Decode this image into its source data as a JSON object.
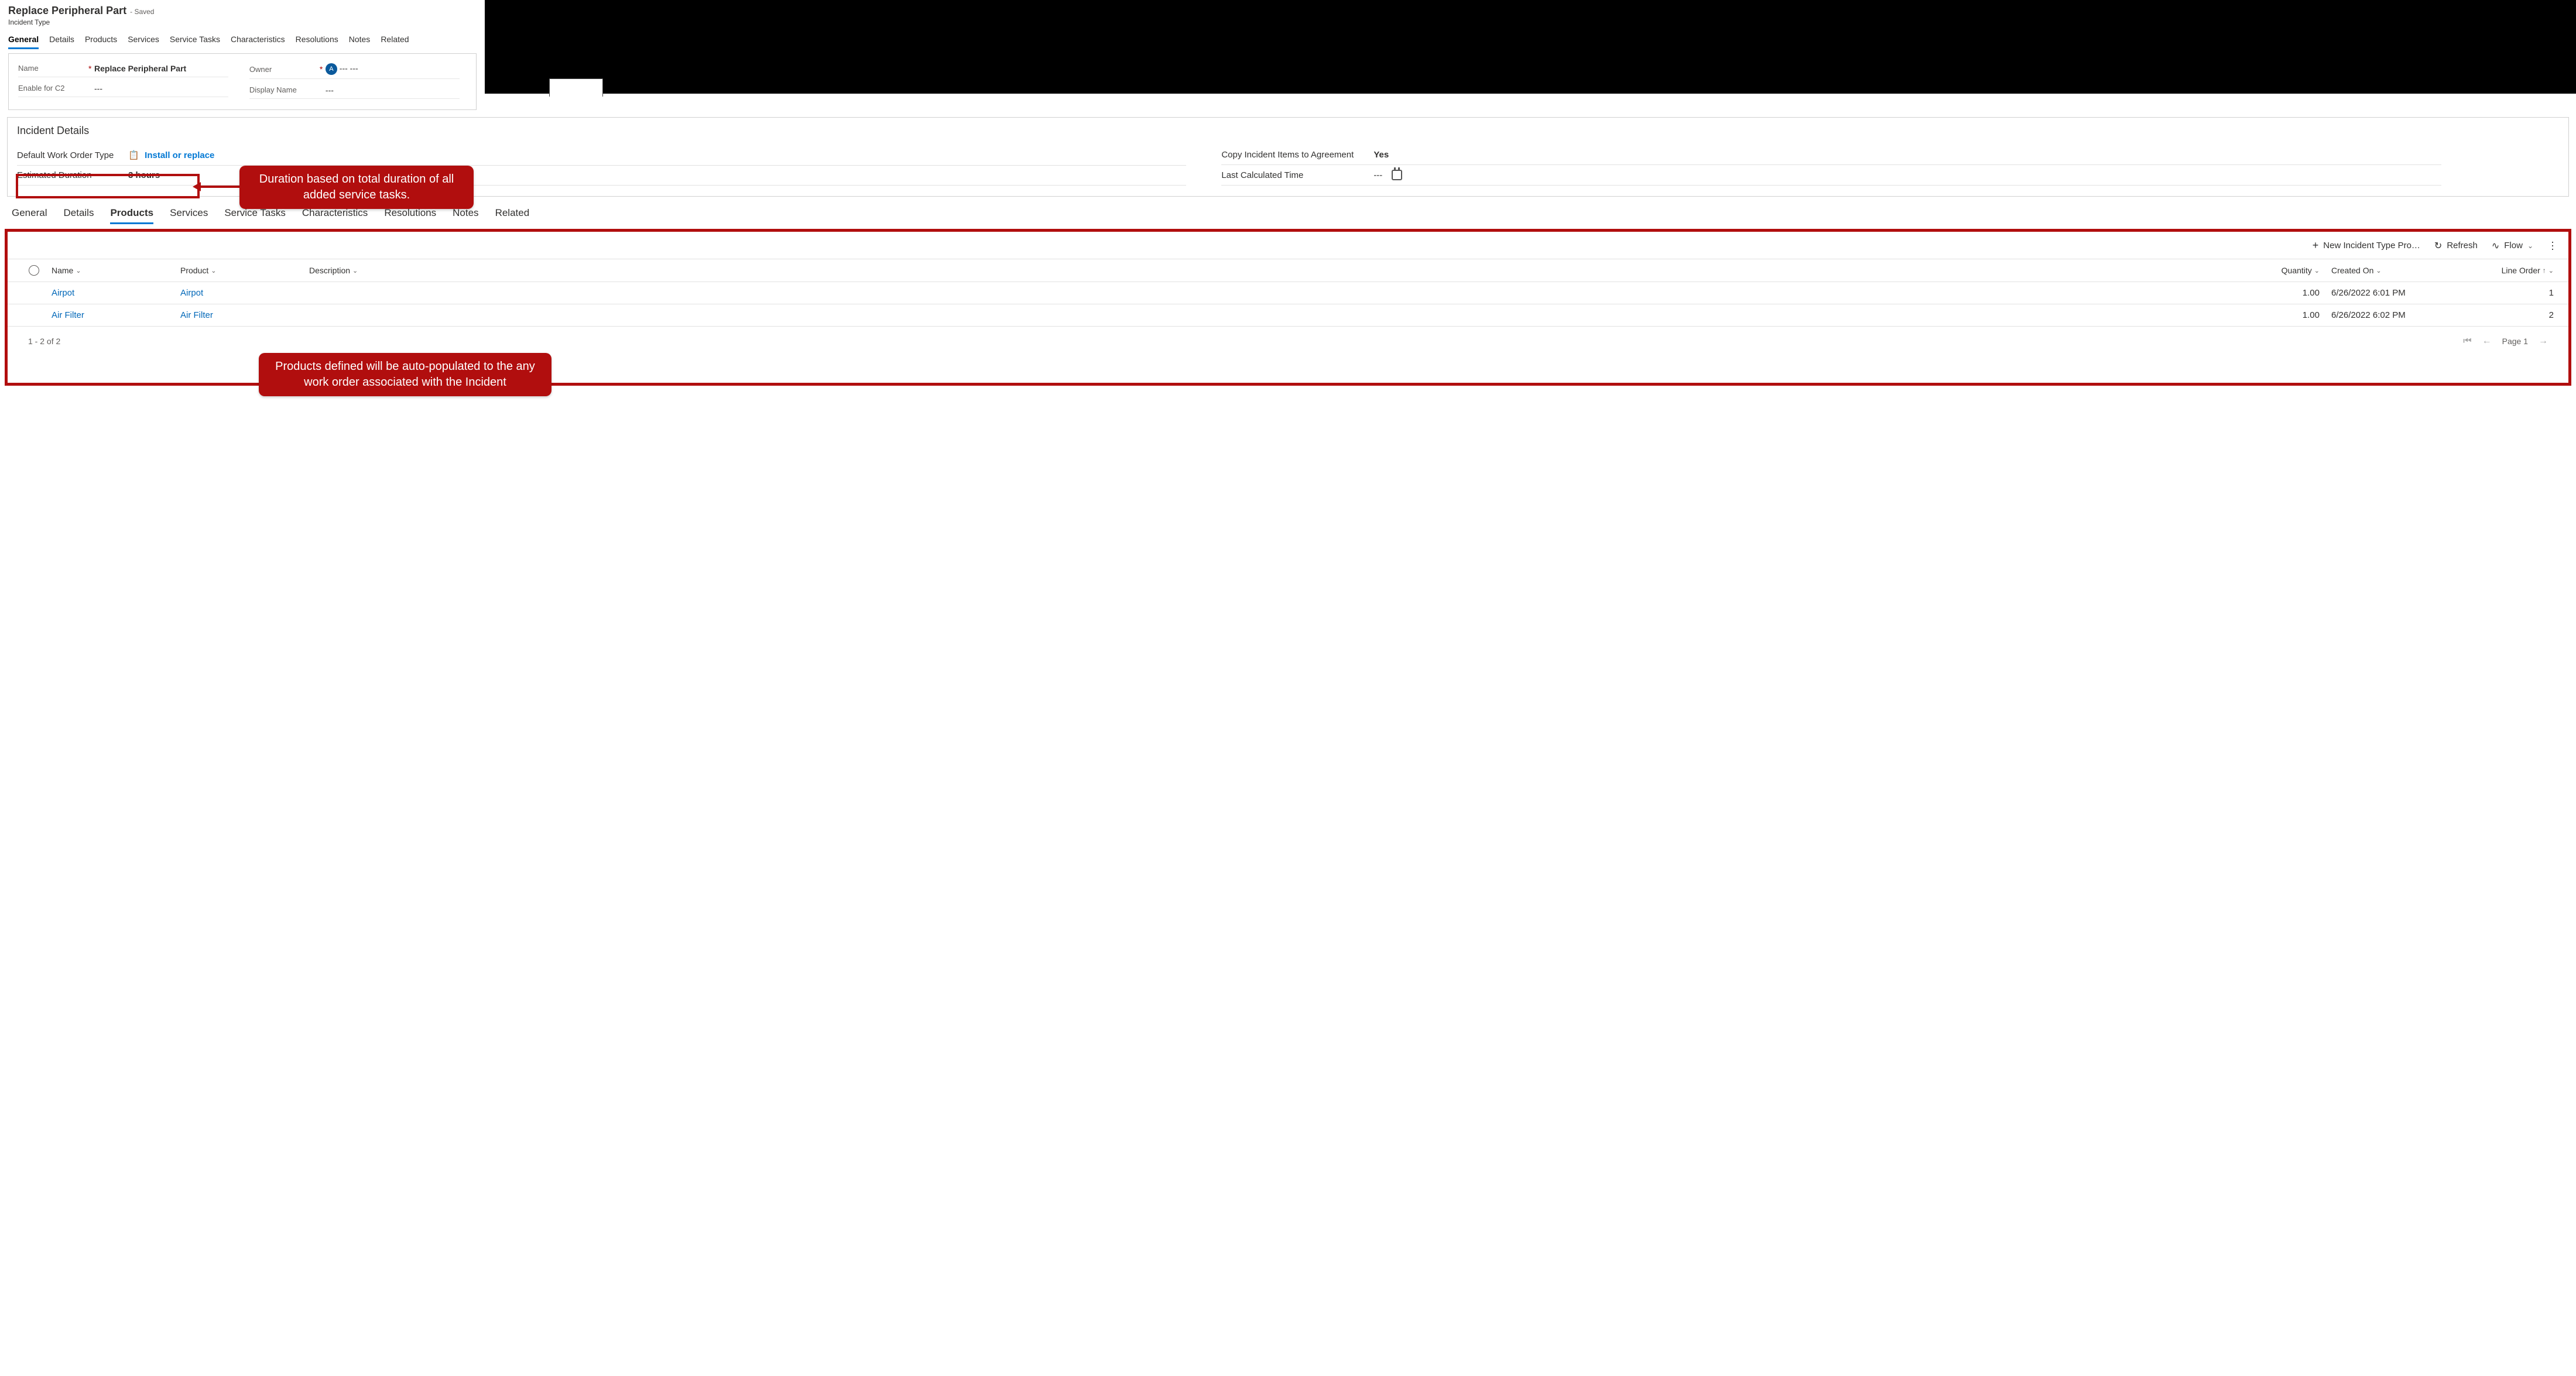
{
  "header": {
    "title": "Replace Peripheral Part",
    "saved": "- Saved",
    "subtitle": "Incident Type"
  },
  "tabs1": [
    "General",
    "Details",
    "Products",
    "Services",
    "Service Tasks",
    "Characteristics",
    "Resolutions",
    "Notes",
    "Related"
  ],
  "tabs1_active": 0,
  "form": {
    "name_label": "Name",
    "name_value": "Replace Peripheral Part",
    "c2_label": "Enable for C2",
    "c2_value": "---",
    "owner_label": "Owner",
    "owner_value": "--- ---",
    "dn_label": "Display Name",
    "dn_value": "---"
  },
  "details": {
    "title": "Incident Details",
    "wot_label": "Default Work Order Type",
    "wot_value": "Install or replace",
    "est_label": "Estimated Duration",
    "est_value": "3 hours",
    "copy_label": "Copy Incident Items to Agreement",
    "copy_value": "Yes",
    "calc_label": "Last Calculated Time",
    "calc_value": "---"
  },
  "note1": "Duration based on total duration of all added service tasks.",
  "tabs2": [
    "General",
    "Details",
    "Products",
    "Services",
    "Service Tasks",
    "Characteristics",
    "Resolutions",
    "Notes",
    "Related"
  ],
  "tabs2_active": 2,
  "toolbar": {
    "new": "New Incident Type Pro…",
    "refresh": "Refresh",
    "flow": "Flow"
  },
  "columns": {
    "name": "Name",
    "product": "Product",
    "desc": "Description",
    "qty": "Quantity",
    "created": "Created On",
    "order": "Line Order"
  },
  "rows": [
    {
      "name": "Airpot",
      "product": "Airpot",
      "desc": "",
      "qty": "1.00",
      "created": "6/26/2022 6:01 PM",
      "order": "1"
    },
    {
      "name": "Air Filter",
      "product": "Air Filter",
      "desc": "",
      "qty": "1.00",
      "created": "6/26/2022 6:02 PM",
      "order": "2"
    }
  ],
  "note2": "Products defined will be auto-populated to the any work order associated with the Incident",
  "footer": {
    "range": "1 - 2 of 2",
    "page": "Page 1"
  }
}
